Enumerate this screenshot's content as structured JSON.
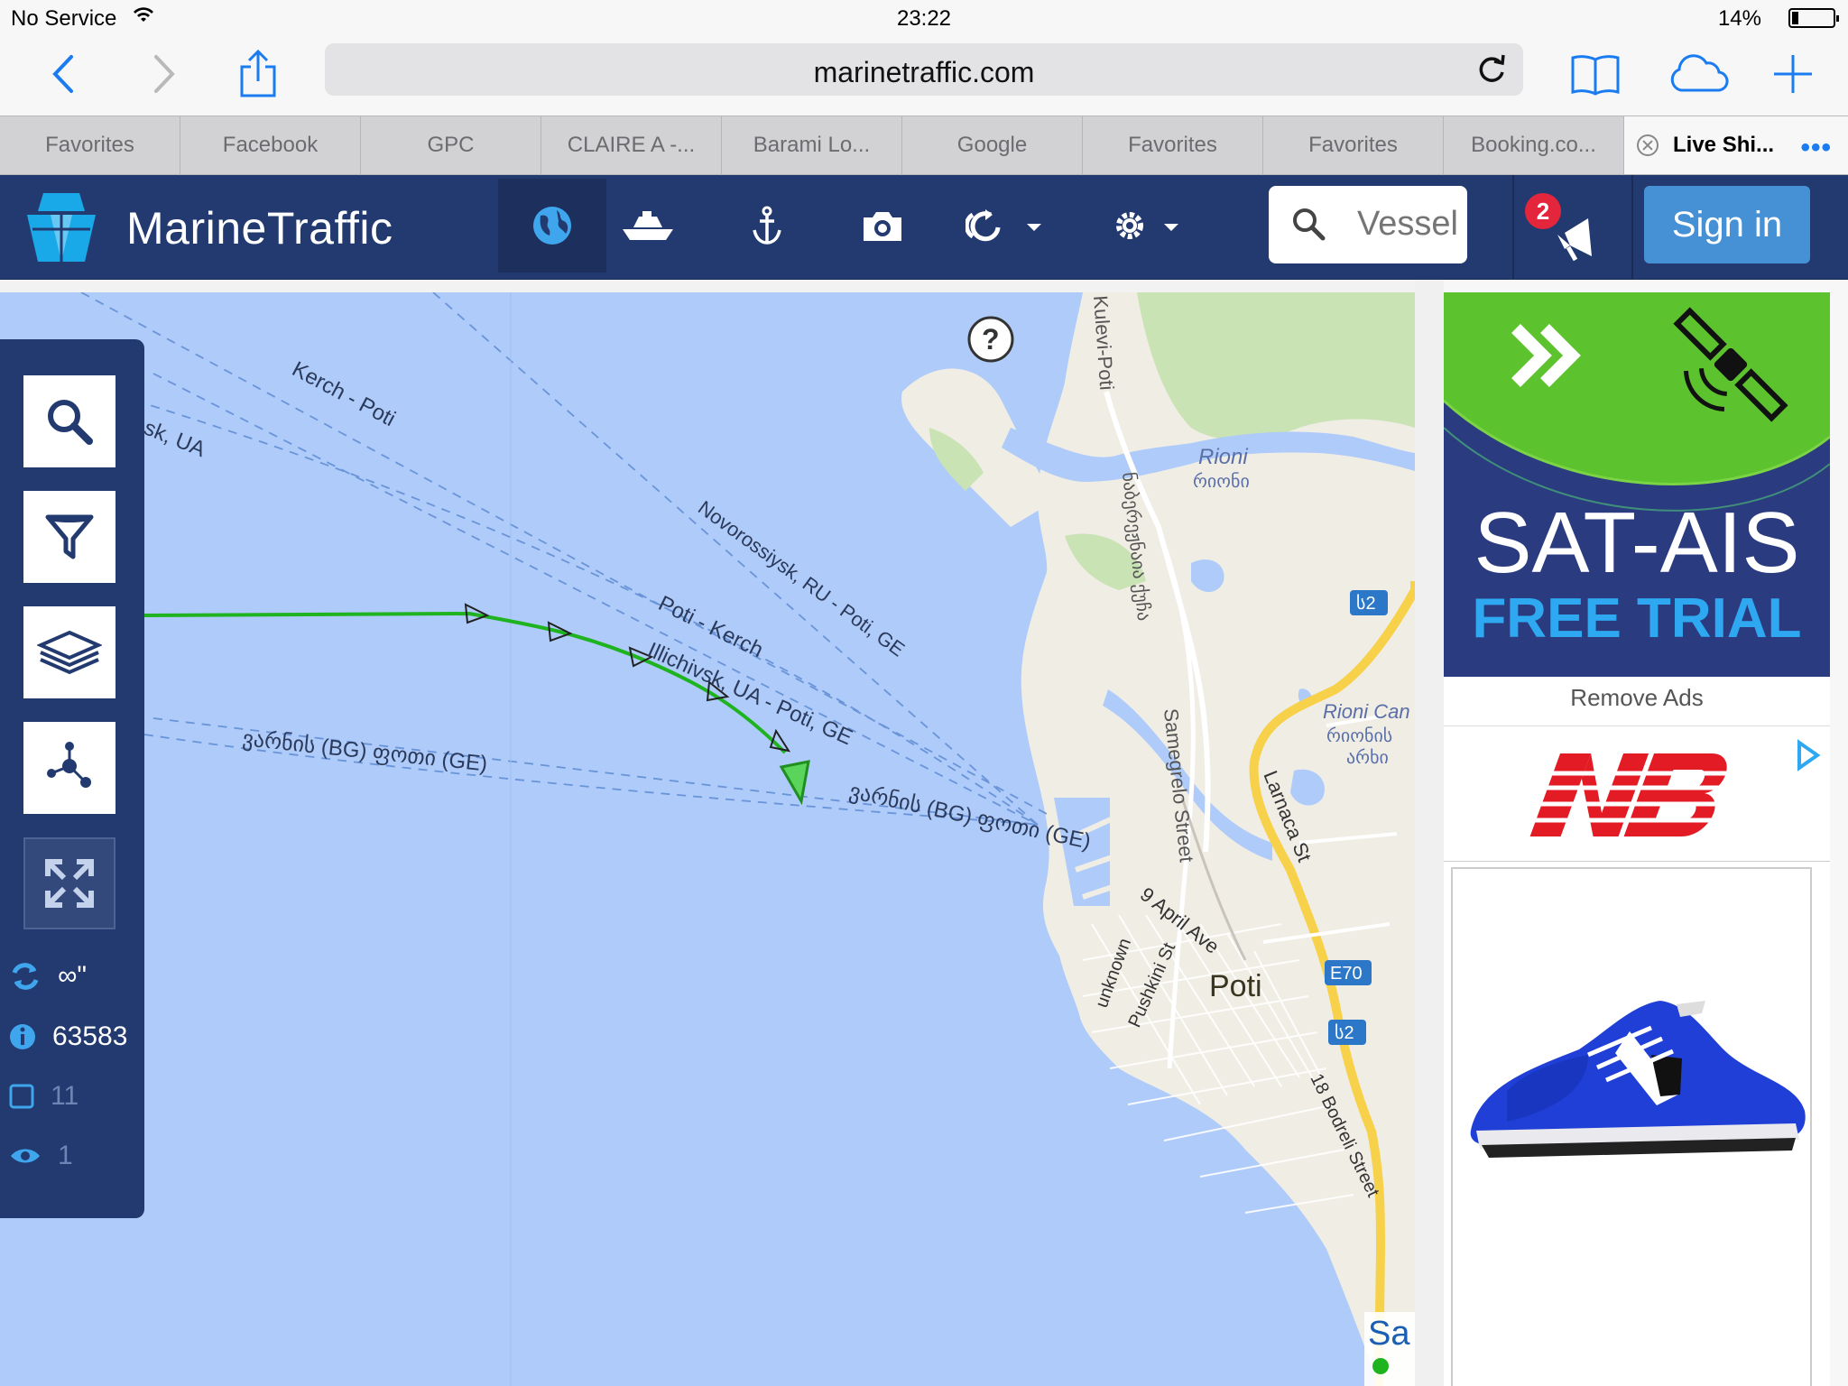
{
  "status_bar": {
    "carrier": "No Service",
    "time": "23:22",
    "battery": "14%"
  },
  "browser": {
    "url": "marinetraffic.com",
    "tabs": [
      {
        "label": "Favorites"
      },
      {
        "label": "Facebook"
      },
      {
        "label": "GPC"
      },
      {
        "label": "CLAIRE A -..."
      },
      {
        "label": "Barami Lo..."
      },
      {
        "label": "Google"
      },
      {
        "label": "Favorites"
      },
      {
        "label": "Favorites"
      },
      {
        "label": "Booking.co..."
      },
      {
        "label": "Live Shi..."
      }
    ],
    "more": "•••"
  },
  "site": {
    "logo": "MarineTraffic",
    "search_placeholder": "Vessel",
    "notification_count": "2",
    "signin_label": "Sign in"
  },
  "panel": {
    "refresh_label": "∞\"",
    "vessel_count": "63583",
    "checked_count": "11",
    "visible_count": "1"
  },
  "map": {
    "help": "?",
    "routes": [
      "Kerch - Poti",
      "sk, UA",
      "Novorossiysk, RU - Poti, GE",
      "Poti - Kerch",
      "Illichivsk, UA - Poti, GE",
      "ვარნის (BG) ფოთი (GE)",
      "ვარნის (BG) ფოთი (GE)"
    ],
    "streets": [
      "Kulevi-Poti",
      "Rioni",
      "რიონი",
      "ნაბერეჟნაია ქუჩა",
      "Samegrelo Street",
      "Rioni Can",
      "რიონის",
      "არხი",
      "Larnaca St",
      "9 April Ave",
      "unknown",
      "Pushkini St",
      "Poti",
      "18 Bodreli Street"
    ],
    "road_shields": [
      "ს2",
      "E70",
      "ს2"
    ],
    "corner_text": "Sa",
    "colors": {
      "water": "#aecbfa",
      "land": "#f0ede5",
      "route_green": "#1fb31f"
    }
  },
  "ads": {
    "sat_title": "SAT-AIS",
    "sat_subtitle": "FREE TRIAL",
    "remove_ads": "Remove Ads"
  }
}
